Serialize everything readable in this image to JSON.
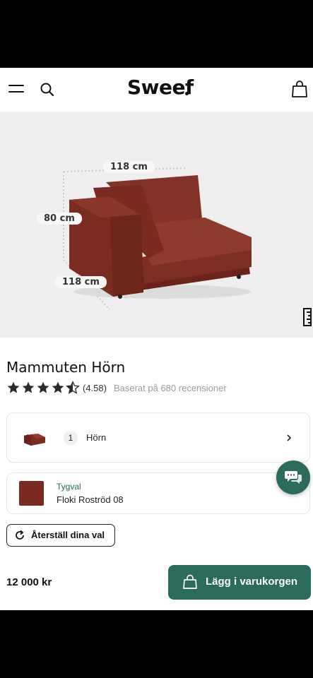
{
  "header": {
    "logo": "Sweef",
    "menu_icon": "hamburger-menu-icon",
    "search_icon": "search-icon",
    "cart_icon": "shopping-bag-icon"
  },
  "hero": {
    "image": "corner-sofa-rust-red",
    "dimensions": {
      "width": "118 cm",
      "height": "80 cm",
      "depth": "118 cm"
    },
    "ruler_icon": "ruler-icon"
  },
  "product": {
    "title": "Mammuten Hörn",
    "rating": 4.58,
    "rating_label": "(4.58)",
    "reviews_label": "Baserat på 680 recensioner"
  },
  "options": {
    "module": {
      "quantity": "1",
      "label": "Hörn"
    },
    "fabric": {
      "caption": "Tygval",
      "name": "Floki Roströd 08",
      "color": "#7a2b20"
    }
  },
  "actions": {
    "reset_label": "Återställ dina val",
    "price": "12 000 kr",
    "add_to_cart_label": "Lägg i varukorgen"
  },
  "colors": {
    "accent": "#2a6b5c",
    "sofa": "#7d2e22"
  }
}
